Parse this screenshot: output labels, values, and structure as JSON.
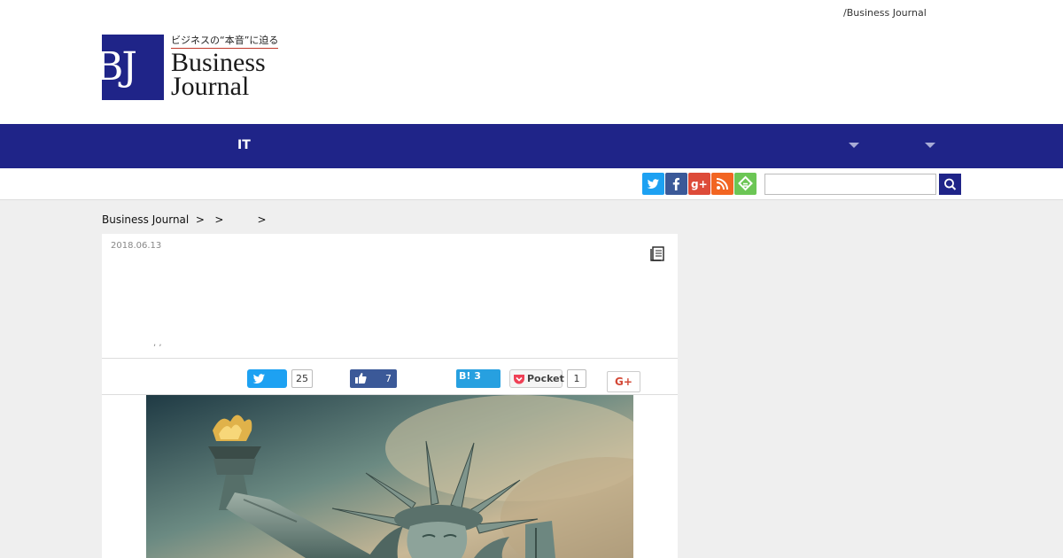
{
  "header": {
    "top_link": "/Business Journal",
    "logo": {
      "tagline": "ビジネスの“本音”に迫る",
      "mark": "BJ",
      "word1": "Business",
      "word2": "Journal"
    }
  },
  "nav": {
    "items": [
      {
        "label": "IT"
      }
    ]
  },
  "toolbar": {
    "search": {
      "placeholder": "",
      "value": ""
    }
  },
  "breadcrumb": {
    "text": "Business Journal  >   >          >"
  },
  "article": {
    "date": "2018.06.13",
    "byline": ", ,",
    "share": {
      "twitter_count": "25",
      "facebook_count": "7",
      "hatena_label": "B! 3",
      "pocket_label": "Pocket",
      "pocket_count": "1",
      "gplus_label": "G+"
    },
    "image_subject": "statue-of-liberty"
  },
  "colors": {
    "brand": "#1f2488",
    "twitter": "#1da1f2",
    "facebook": "#3b5998",
    "gplus": "#dd4b39",
    "rss": "#f26522",
    "feedly": "#6cc655",
    "hatena": "#27a0e0",
    "pocket": "#ef4056"
  }
}
